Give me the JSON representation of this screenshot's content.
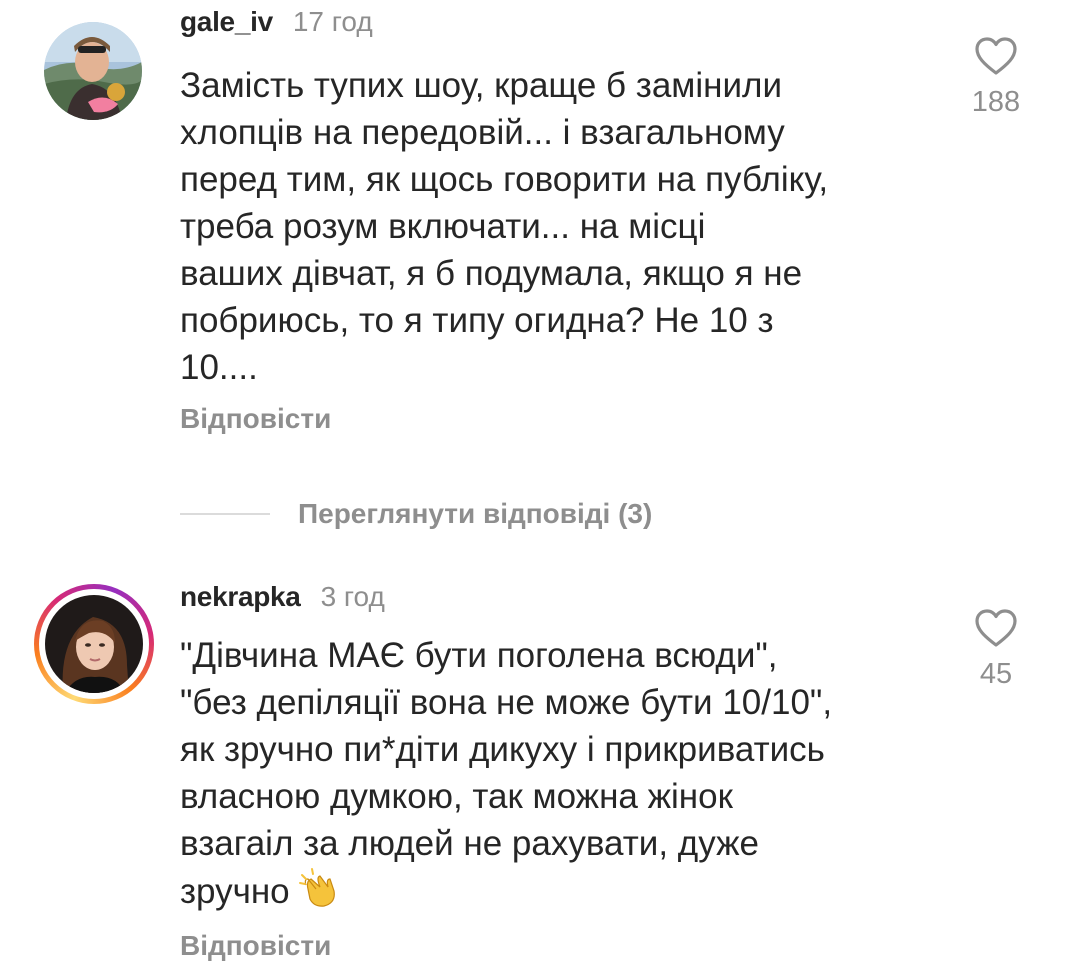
{
  "comments": [
    {
      "username": "gale_iv",
      "time": "17 год",
      "text": "Замість тупих шоу, краще б замінили\nхлопців на передовій... і взагальному\nперед тим, як щось говорити на публіку,\nтреба розум включати... на місці\nваших дівчат, я б подумала, якщо я не\nпобриюсь, то я типу огидна? Не 10 з\n10....",
      "reply_label": "Відповісти",
      "likes": "188",
      "avatar_icon": "user-photo-avatar"
    },
    {
      "username": "nekrapka",
      "time": "3 год",
      "text": "\"Дівчина МАЄ бути поголена всюди\",\n\"без депіляції вона не може бути 10/10\",\nяк зручно пи*діти дикуху і прикриватись\nвласною думкою, так можна жінок\nвзагаіл за людей не рахувати, дуже\nзручно",
      "emoji": "clapping-hands-emoji",
      "reply_label": "Відповісти",
      "likes": "45",
      "avatar_icon": "user-photo-avatar-with-story-ring"
    }
  ],
  "view_replies_label": "Переглянути відповіді (3)",
  "colors": {
    "text": "#262626",
    "secondary": "#8e8e8e",
    "divider": "#dbdbdb",
    "story_ring": [
      "#feda75",
      "#fa7e1e",
      "#d62976",
      "#962fbf"
    ]
  }
}
